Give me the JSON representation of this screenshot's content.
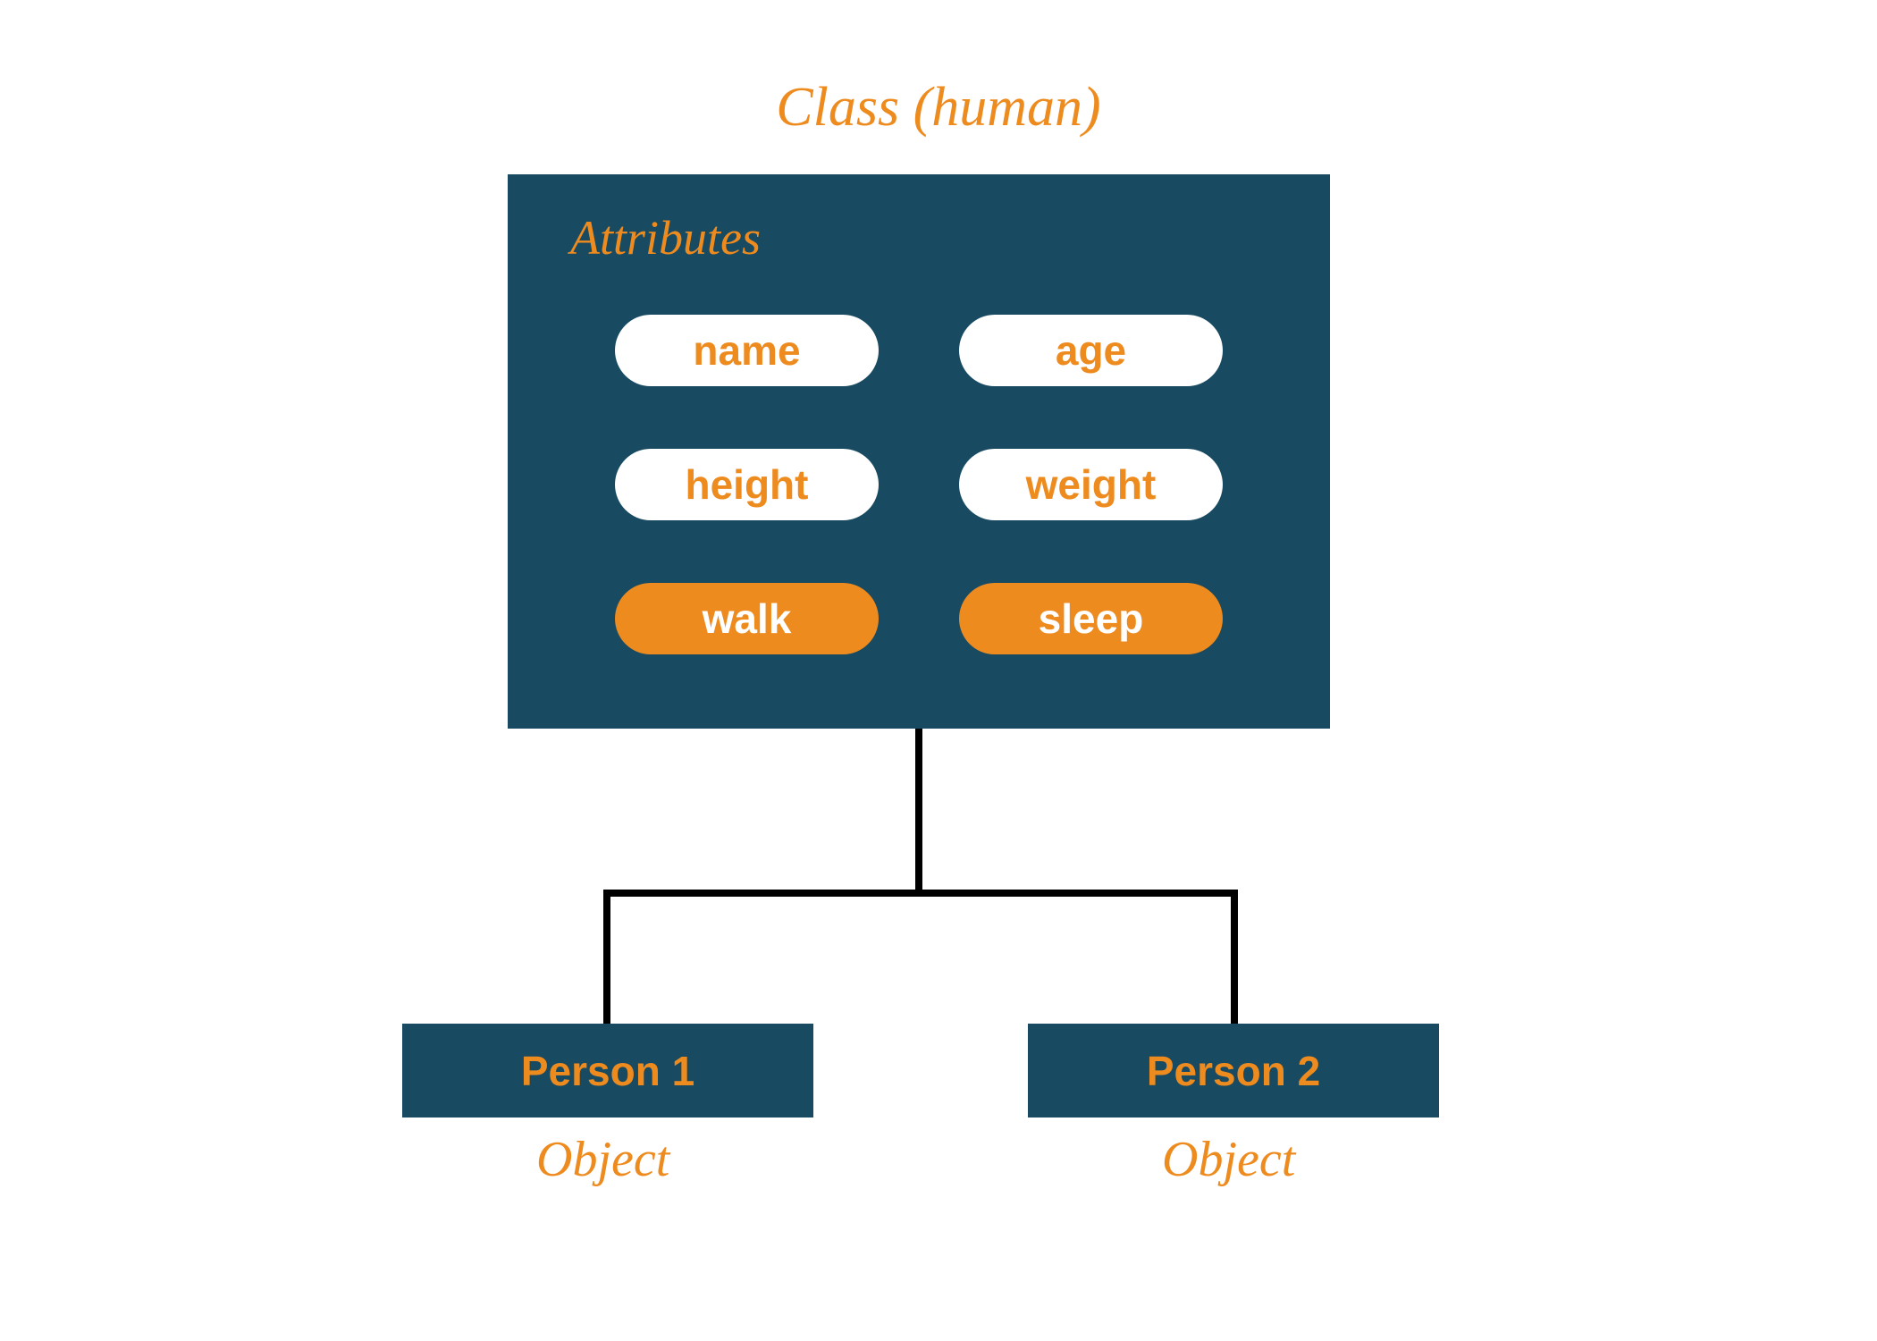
{
  "diagram": {
    "title": "Class (human)",
    "class_box": {
      "attributes_label": "Attributes",
      "attributes": [
        {
          "label": "name",
          "type": "property"
        },
        {
          "label": "age",
          "type": "property"
        },
        {
          "label": "height",
          "type": "property"
        },
        {
          "label": "weight",
          "type": "property"
        },
        {
          "label": "walk",
          "type": "method"
        },
        {
          "label": "sleep",
          "type": "method"
        }
      ]
    },
    "objects": [
      {
        "label": "Person 1",
        "caption": "Object"
      },
      {
        "label": "Person 2",
        "caption": "Object"
      }
    ]
  }
}
